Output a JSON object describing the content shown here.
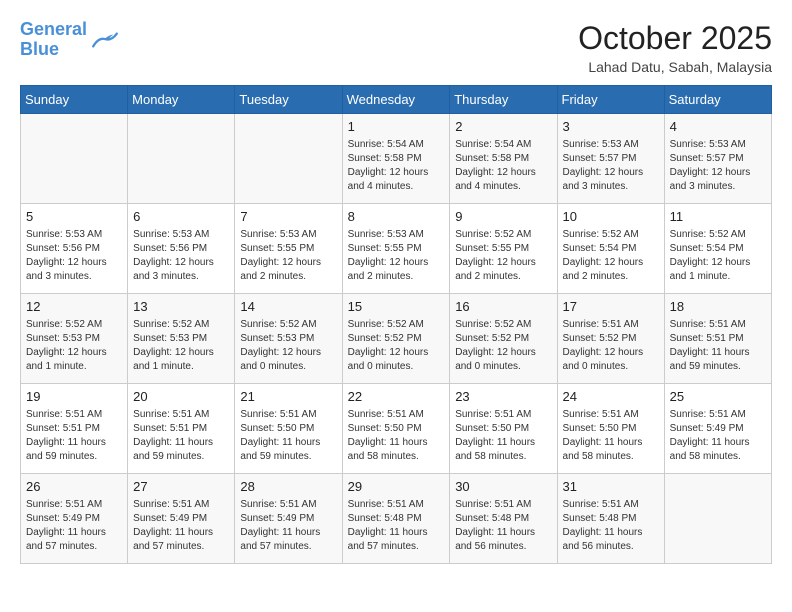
{
  "header": {
    "logo_line1": "General",
    "logo_line2": "Blue",
    "month_title": "October 2025",
    "location": "Lahad Datu, Sabah, Malaysia"
  },
  "days_of_week": [
    "Sunday",
    "Monday",
    "Tuesday",
    "Wednesday",
    "Thursday",
    "Friday",
    "Saturday"
  ],
  "weeks": [
    [
      {
        "day": "",
        "info": ""
      },
      {
        "day": "",
        "info": ""
      },
      {
        "day": "",
        "info": ""
      },
      {
        "day": "1",
        "info": "Sunrise: 5:54 AM\nSunset: 5:58 PM\nDaylight: 12 hours\nand 4 minutes."
      },
      {
        "day": "2",
        "info": "Sunrise: 5:54 AM\nSunset: 5:58 PM\nDaylight: 12 hours\nand 4 minutes."
      },
      {
        "day": "3",
        "info": "Sunrise: 5:53 AM\nSunset: 5:57 PM\nDaylight: 12 hours\nand 3 minutes."
      },
      {
        "day": "4",
        "info": "Sunrise: 5:53 AM\nSunset: 5:57 PM\nDaylight: 12 hours\nand 3 minutes."
      }
    ],
    [
      {
        "day": "5",
        "info": "Sunrise: 5:53 AM\nSunset: 5:56 PM\nDaylight: 12 hours\nand 3 minutes."
      },
      {
        "day": "6",
        "info": "Sunrise: 5:53 AM\nSunset: 5:56 PM\nDaylight: 12 hours\nand 3 minutes."
      },
      {
        "day": "7",
        "info": "Sunrise: 5:53 AM\nSunset: 5:55 PM\nDaylight: 12 hours\nand 2 minutes."
      },
      {
        "day": "8",
        "info": "Sunrise: 5:53 AM\nSunset: 5:55 PM\nDaylight: 12 hours\nand 2 minutes."
      },
      {
        "day": "9",
        "info": "Sunrise: 5:52 AM\nSunset: 5:55 PM\nDaylight: 12 hours\nand 2 minutes."
      },
      {
        "day": "10",
        "info": "Sunrise: 5:52 AM\nSunset: 5:54 PM\nDaylight: 12 hours\nand 2 minutes."
      },
      {
        "day": "11",
        "info": "Sunrise: 5:52 AM\nSunset: 5:54 PM\nDaylight: 12 hours\nand 1 minute."
      }
    ],
    [
      {
        "day": "12",
        "info": "Sunrise: 5:52 AM\nSunset: 5:53 PM\nDaylight: 12 hours\nand 1 minute."
      },
      {
        "day": "13",
        "info": "Sunrise: 5:52 AM\nSunset: 5:53 PM\nDaylight: 12 hours\nand 1 minute."
      },
      {
        "day": "14",
        "info": "Sunrise: 5:52 AM\nSunset: 5:53 PM\nDaylight: 12 hours\nand 0 minutes."
      },
      {
        "day": "15",
        "info": "Sunrise: 5:52 AM\nSunset: 5:52 PM\nDaylight: 12 hours\nand 0 minutes."
      },
      {
        "day": "16",
        "info": "Sunrise: 5:52 AM\nSunset: 5:52 PM\nDaylight: 12 hours\nand 0 minutes."
      },
      {
        "day": "17",
        "info": "Sunrise: 5:51 AM\nSunset: 5:52 PM\nDaylight: 12 hours\nand 0 minutes."
      },
      {
        "day": "18",
        "info": "Sunrise: 5:51 AM\nSunset: 5:51 PM\nDaylight: 11 hours\nand 59 minutes."
      }
    ],
    [
      {
        "day": "19",
        "info": "Sunrise: 5:51 AM\nSunset: 5:51 PM\nDaylight: 11 hours\nand 59 minutes."
      },
      {
        "day": "20",
        "info": "Sunrise: 5:51 AM\nSunset: 5:51 PM\nDaylight: 11 hours\nand 59 minutes."
      },
      {
        "day": "21",
        "info": "Sunrise: 5:51 AM\nSunset: 5:50 PM\nDaylight: 11 hours\nand 59 minutes."
      },
      {
        "day": "22",
        "info": "Sunrise: 5:51 AM\nSunset: 5:50 PM\nDaylight: 11 hours\nand 58 minutes."
      },
      {
        "day": "23",
        "info": "Sunrise: 5:51 AM\nSunset: 5:50 PM\nDaylight: 11 hours\nand 58 minutes."
      },
      {
        "day": "24",
        "info": "Sunrise: 5:51 AM\nSunset: 5:50 PM\nDaylight: 11 hours\nand 58 minutes."
      },
      {
        "day": "25",
        "info": "Sunrise: 5:51 AM\nSunset: 5:49 PM\nDaylight: 11 hours\nand 58 minutes."
      }
    ],
    [
      {
        "day": "26",
        "info": "Sunrise: 5:51 AM\nSunset: 5:49 PM\nDaylight: 11 hours\nand 57 minutes."
      },
      {
        "day": "27",
        "info": "Sunrise: 5:51 AM\nSunset: 5:49 PM\nDaylight: 11 hours\nand 57 minutes."
      },
      {
        "day": "28",
        "info": "Sunrise: 5:51 AM\nSunset: 5:49 PM\nDaylight: 11 hours\nand 57 minutes."
      },
      {
        "day": "29",
        "info": "Sunrise: 5:51 AM\nSunset: 5:48 PM\nDaylight: 11 hours\nand 57 minutes."
      },
      {
        "day": "30",
        "info": "Sunrise: 5:51 AM\nSunset: 5:48 PM\nDaylight: 11 hours\nand 56 minutes."
      },
      {
        "day": "31",
        "info": "Sunrise: 5:51 AM\nSunset: 5:48 PM\nDaylight: 11 hours\nand 56 minutes."
      },
      {
        "day": "",
        "info": ""
      }
    ]
  ]
}
